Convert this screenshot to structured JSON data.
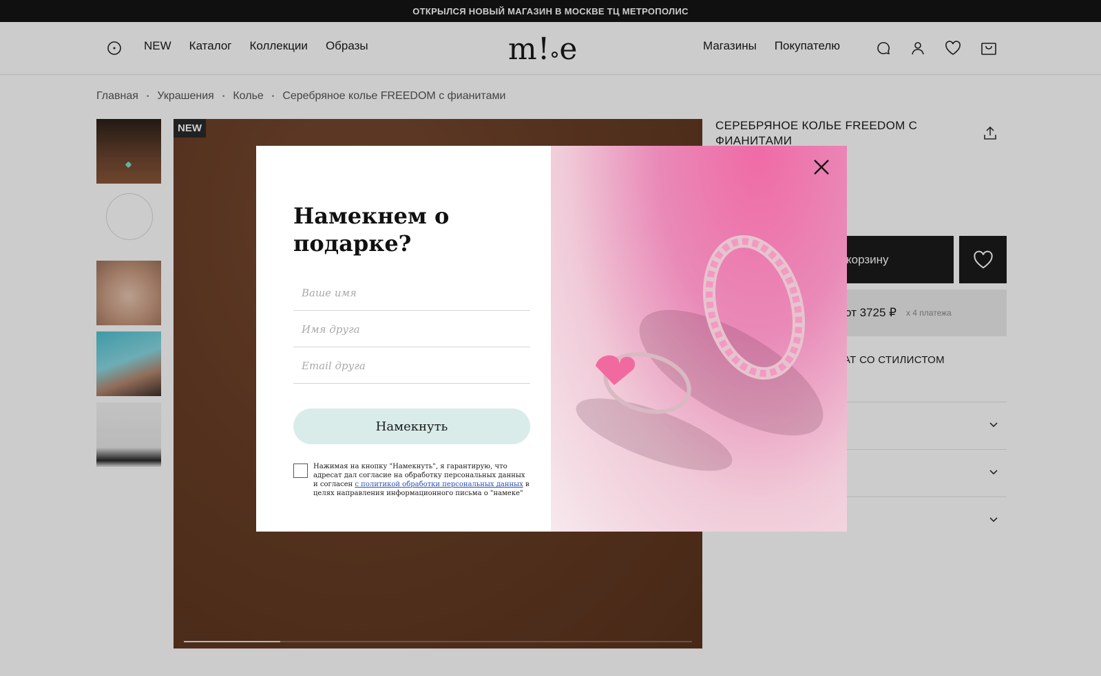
{
  "announcement": "ОТКРЫЛСЯ НОВЫЙ МАГАЗИН В МОСКВЕ ТЦ МЕТРОПОЛИС",
  "header": {
    "logo_left": "m",
    "logo_mid": "!",
    "logo_right": "e",
    "nav_left": [
      "NEW",
      "Каталог",
      "Коллекции",
      "Образы"
    ],
    "nav_right": [
      "Магазины",
      "Покупателю"
    ]
  },
  "breadcrumb": [
    "Главная",
    "Украшения",
    "Колье",
    "Серебряное колье FREEDOM с фианитами"
  ],
  "gallery": {
    "badge": "NEW",
    "progress": 0.19
  },
  "product": {
    "title": "СЕРЕБРЯНОЕ КОЛЬЕ FREEDOM С ФИАНИТАМИ",
    "cart_label": "корзину",
    "split_price": "от 3725 ₽",
    "split_note": "х 4 платежа",
    "stylist": "ат со стилистом"
  },
  "modal": {
    "title": "Намекнем о подарке?",
    "fields": {
      "name_placeholder": "Ваше имя",
      "friend_name_placeholder": "Имя друга",
      "friend_email_placeholder": "Email друга"
    },
    "submit_label": "Намекнуть",
    "consent_before": "Нажимая на кнопку \"Намекнуть\", я гарантирую, что адресат дал согласие на обработку персональных данных и согласен ",
    "consent_link": "с политикой обработки персональных данных",
    "consent_after": " в целях направления информационного письма о \"намеке\""
  }
}
